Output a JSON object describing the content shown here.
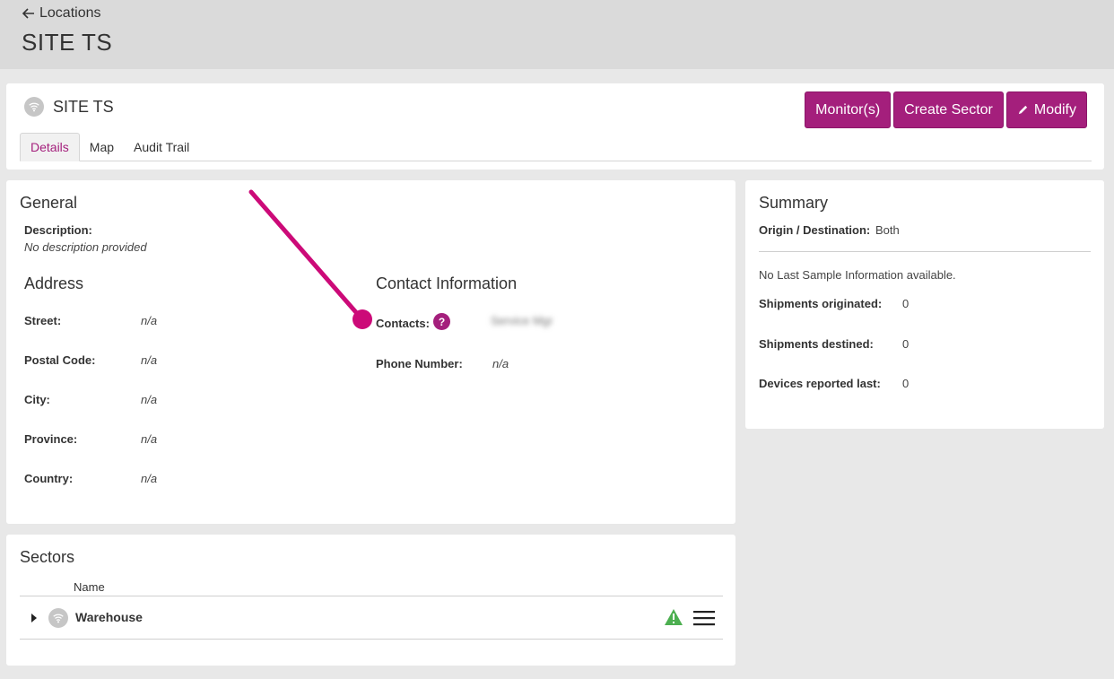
{
  "header": {
    "back_label": "Locations",
    "page_title": "SITE TS"
  },
  "site": {
    "name": "SITE TS",
    "buttons": {
      "monitors": "Monitor(s)",
      "create_sector": "Create Sector",
      "modify": "Modify"
    },
    "tabs": [
      "Details",
      "Map",
      "Audit Trail"
    ],
    "active_tab": "Details"
  },
  "general": {
    "title": "General",
    "description_label": "Description:",
    "description_value": "No description provided"
  },
  "address": {
    "title": "Address",
    "fields": [
      {
        "label": "Street:",
        "value": "n/a"
      },
      {
        "label": "Postal Code:",
        "value": "n/a"
      },
      {
        "label": "City:",
        "value": "n/a"
      },
      {
        "label": "Province:",
        "value": "n/a"
      },
      {
        "label": "Country:",
        "value": "n/a"
      }
    ]
  },
  "contact": {
    "title": "Contact Information",
    "contacts_label": "Contacts:",
    "help_glyph": "?",
    "contacts_value": "Service Mgr",
    "phone_label": "Phone Number:",
    "phone_value": "n/a"
  },
  "summary": {
    "title": "Summary",
    "origin_label": "Origin / Destination:",
    "origin_value": "Both",
    "no_sample_text": "No Last Sample Information available.",
    "stats": [
      {
        "label": "Shipments originated:",
        "value": "0"
      },
      {
        "label": "Shipments destined:",
        "value": "0"
      },
      {
        "label": "Devices reported last:",
        "value": "0"
      }
    ]
  },
  "sectors": {
    "title": "Sectors",
    "column_name": "Name",
    "rows": [
      {
        "name": "Warehouse"
      }
    ]
  },
  "colors": {
    "brand": "#a41f7c",
    "annotation": "#cc0a78",
    "warning": "#4caf50"
  },
  "icons": {
    "back": "arrow-left-icon",
    "wifi": "wifi-icon",
    "edit": "pencil-icon",
    "help": "question-icon",
    "warning": "warning-triangle-icon",
    "menu": "hamburger-menu-icon",
    "expand": "caret-right-icon"
  }
}
